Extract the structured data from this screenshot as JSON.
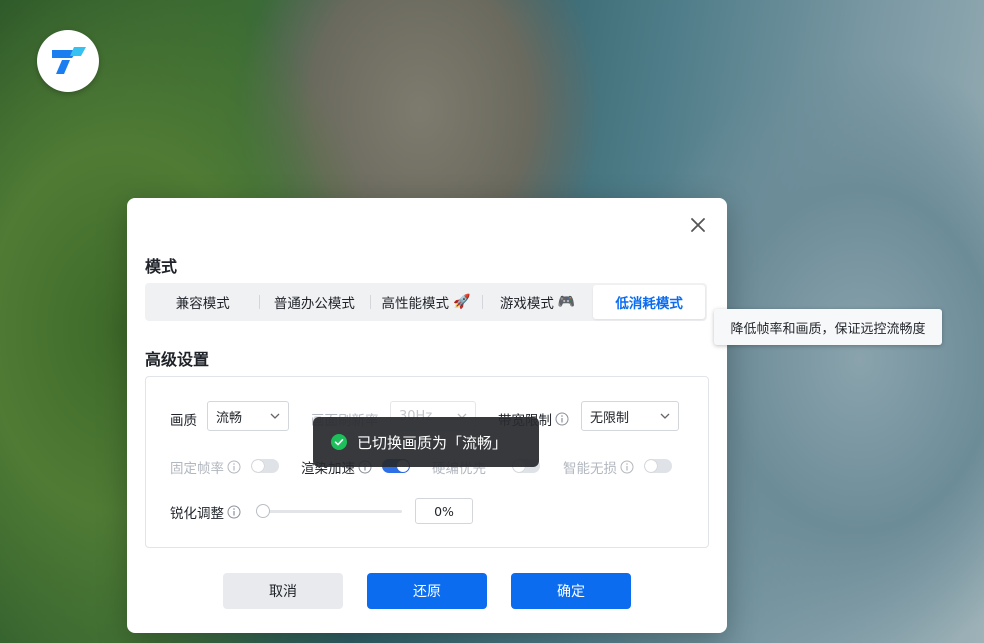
{
  "app": {
    "logo_icon": "todesk-logo-icon"
  },
  "dialog": {
    "mode_title": "模式",
    "mode_tabs": [
      {
        "label": "兼容模式",
        "emoji": ""
      },
      {
        "label": "普通办公模式",
        "emoji": ""
      },
      {
        "label": "高性能模式",
        "emoji": "🚀"
      },
      {
        "label": "游戏模式",
        "emoji": "🎮"
      },
      {
        "label": "低消耗模式",
        "emoji": ""
      }
    ],
    "active_tab": "低消耗模式",
    "advanced_title": "高级设置",
    "quality": {
      "label": "画质",
      "value": "流畅"
    },
    "refresh_rate": {
      "label": "画面刷新率",
      "value": "30Hz"
    },
    "bandwidth": {
      "label": "带宽限制",
      "value": "无限制"
    },
    "fixed_fps": {
      "label": "固定帧率",
      "on": false
    },
    "render_accel": {
      "label": "渲染加速",
      "on": true
    },
    "hw_optimize": {
      "label": "硬编优先",
      "on": false
    },
    "smart_lossless": {
      "label": "智能无损",
      "on": false
    },
    "sharpen": {
      "label": "锐化调整",
      "value": "0%",
      "level": 0
    },
    "buttons": {
      "cancel": "取消",
      "restore": "还原",
      "confirm": "确定"
    }
  },
  "toast": {
    "text": "已切换画质为「流畅」"
  },
  "tooltip": {
    "text": "降低帧率和画质，保证远控流畅度"
  },
  "colors": {
    "accent": "#0b6cf0",
    "toast_bg": "#2a2b2e",
    "success": "#1dbf5a"
  }
}
